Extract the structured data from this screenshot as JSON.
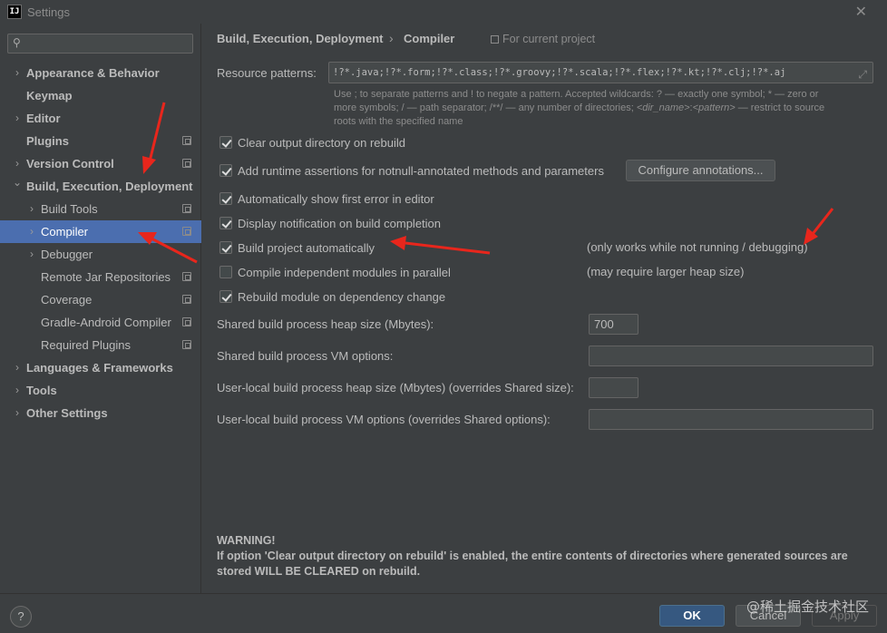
{
  "window": {
    "title": "Settings",
    "app_icon_text": "IJ"
  },
  "colors": {
    "accent_selection": "#4b6eaf",
    "ok_button": "#365880",
    "annotation_arrow": "#e8261c"
  },
  "sidebar": {
    "search": {
      "value": "",
      "placeholder": ""
    },
    "items": [
      {
        "label": "Appearance & Behavior",
        "bold": true,
        "chevron": "right",
        "project": false
      },
      {
        "label": "Keymap",
        "bold": true,
        "chevron": "",
        "project": false
      },
      {
        "label": "Editor",
        "bold": true,
        "chevron": "right",
        "project": false
      },
      {
        "label": "Plugins",
        "bold": true,
        "chevron": "",
        "project": true
      },
      {
        "label": "Version Control",
        "bold": true,
        "chevron": "right",
        "project": true
      },
      {
        "label": "Build, Execution, Deployment",
        "bold": true,
        "chevron": "down",
        "project": false
      },
      {
        "label": "Build Tools",
        "bold": false,
        "chevron": "right",
        "project": true
      },
      {
        "label": "Compiler",
        "bold": false,
        "chevron": "right",
        "project": true,
        "selected": true
      },
      {
        "label": "Debugger",
        "bold": false,
        "chevron": "right",
        "project": false
      },
      {
        "label": "Remote Jar Repositories",
        "bold": false,
        "chevron": "",
        "project": true
      },
      {
        "label": "Coverage",
        "bold": false,
        "chevron": "",
        "project": true
      },
      {
        "label": "Gradle-Android Compiler",
        "bold": false,
        "chevron": "",
        "project": true
      },
      {
        "label": "Required Plugins",
        "bold": false,
        "chevron": "",
        "project": true
      },
      {
        "label": "Languages & Frameworks",
        "bold": true,
        "chevron": "right",
        "project": false
      },
      {
        "label": "Tools",
        "bold": true,
        "chevron": "right",
        "project": false
      },
      {
        "label": "Other Settings",
        "bold": true,
        "chevron": "right",
        "project": false
      }
    ]
  },
  "breadcrumb": {
    "parent": "Build, Execution, Deployment",
    "separator": "›",
    "current": "Compiler",
    "scope": "For current project"
  },
  "resource_patterns": {
    "label": "Resource patterns:",
    "value": "!?*.java;!?*.form;!?*.class;!?*.groovy;!?*.scala;!?*.flex;!?*.kt;!?*.clj;!?*.aj",
    "hint_line1": "Use ; to separate patterns and ! to negate a pattern. Accepted wildcards: ? — exactly one symbol; * — zero or",
    "hint_line2_a": "more symbols; / — path separator; /**/ — any number of directories; ",
    "hint_line2_dir": "<dir_name>",
    "hint_line2_colon": ":",
    "hint_line2_pattern": "<pattern>",
    "hint_line2_b": " — restrict to source",
    "hint_line3": "roots with the specified name"
  },
  "options": {
    "clear_output": {
      "label": "Clear output directory on rebuild",
      "checked": true
    },
    "runtime_assertions": {
      "label": "Add runtime assertions for notnull-annotated methods and parameters",
      "checked": true
    },
    "configure_annotations": "Configure annotations...",
    "show_first_error": {
      "label": "Automatically show first error in editor",
      "checked": true
    },
    "display_notification": {
      "label": "Display notification on build completion",
      "checked": true
    },
    "build_automatically": {
      "label": "Build project automatically",
      "checked": true,
      "note": "(only works while not running / debugging)"
    },
    "compile_parallel": {
      "label": "Compile independent modules in parallel",
      "checked": false,
      "note": "(may require larger heap size)"
    },
    "rebuild_module": {
      "label": "Rebuild module on dependency change",
      "checked": true
    }
  },
  "fields": {
    "shared_heap": {
      "label": "Shared build process heap size (Mbytes):",
      "value": "700"
    },
    "shared_vm": {
      "label": "Shared build process VM options:",
      "value": ""
    },
    "user_heap": {
      "label": "User-local build process heap size (Mbytes) (overrides Shared size):",
      "value": ""
    },
    "user_vm": {
      "label": "User-local build process VM options (overrides Shared options):",
      "value": ""
    }
  },
  "warning": {
    "title": "WARNING!",
    "text": "If option 'Clear output directory on rebuild' is enabled, the entire contents of directories where generated sources are stored WILL BE CLEARED on rebuild."
  },
  "footer": {
    "help": "?",
    "ok": "OK",
    "cancel": "Cancel",
    "apply": "Apply",
    "watermark": "@稀土掘金技术社区"
  }
}
